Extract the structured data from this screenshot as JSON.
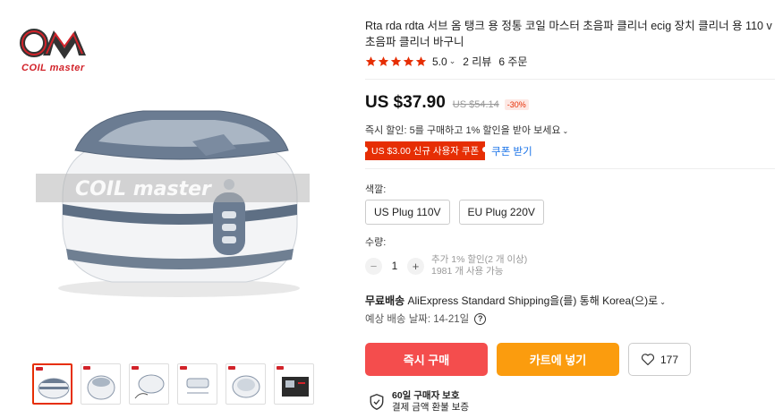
{
  "brand": {
    "logo_text": "COIL master"
  },
  "gallery": {
    "watermark": "COIL master",
    "thumbnails": [
      {
        "active": true
      },
      {
        "active": false
      },
      {
        "active": false
      },
      {
        "active": false
      },
      {
        "active": false
      },
      {
        "active": false
      }
    ]
  },
  "product": {
    "title": "Rta rda rdta 서브 옴 탱크 용 정통 코일 마스터 초음파 클리너 ecig 장치 클리너 용 110 v 초음파 클리너 바구니",
    "rating": "5.0",
    "reviews": "2 리뷰",
    "orders": "6 주문",
    "price": "US $37.90",
    "original_price": "US $54.14",
    "discount": "-30%",
    "instant_discount": "즉시 할인: 5를 구매하고 1% 할인을 받아 보세요",
    "coupon": "US $3.00 신규 사용자 쿠폰",
    "coupon_link": "쿠폰 받기",
    "color_label": "색깔:",
    "options": [
      "US Plug 110V",
      "EU Plug 220V"
    ],
    "quantity_label": "수량:",
    "quantity": "1",
    "quantity_note_1": "추가 1% 할인(2 개 이상)",
    "quantity_note_2": "1981 개 사용 가능",
    "shipping_bold": "무료배송",
    "shipping_rest": "AliExpress Standard Shipping을(를) 통해 Korea(으)로",
    "eta": "예상 배송 날짜: 14-21일",
    "buy_now": "즉시 구매",
    "add_to_cart": "카트에 넣기",
    "wishlist_count": "177",
    "protection_title": "60일 구매자 보호",
    "protection_sub": "결제 금액 환불 보증"
  },
  "colors": {
    "accent": "#e62e04",
    "buy": "#f44d4d",
    "cart": "#fb9c0e",
    "link": "#1a73e8",
    "star": "#e62e04"
  }
}
